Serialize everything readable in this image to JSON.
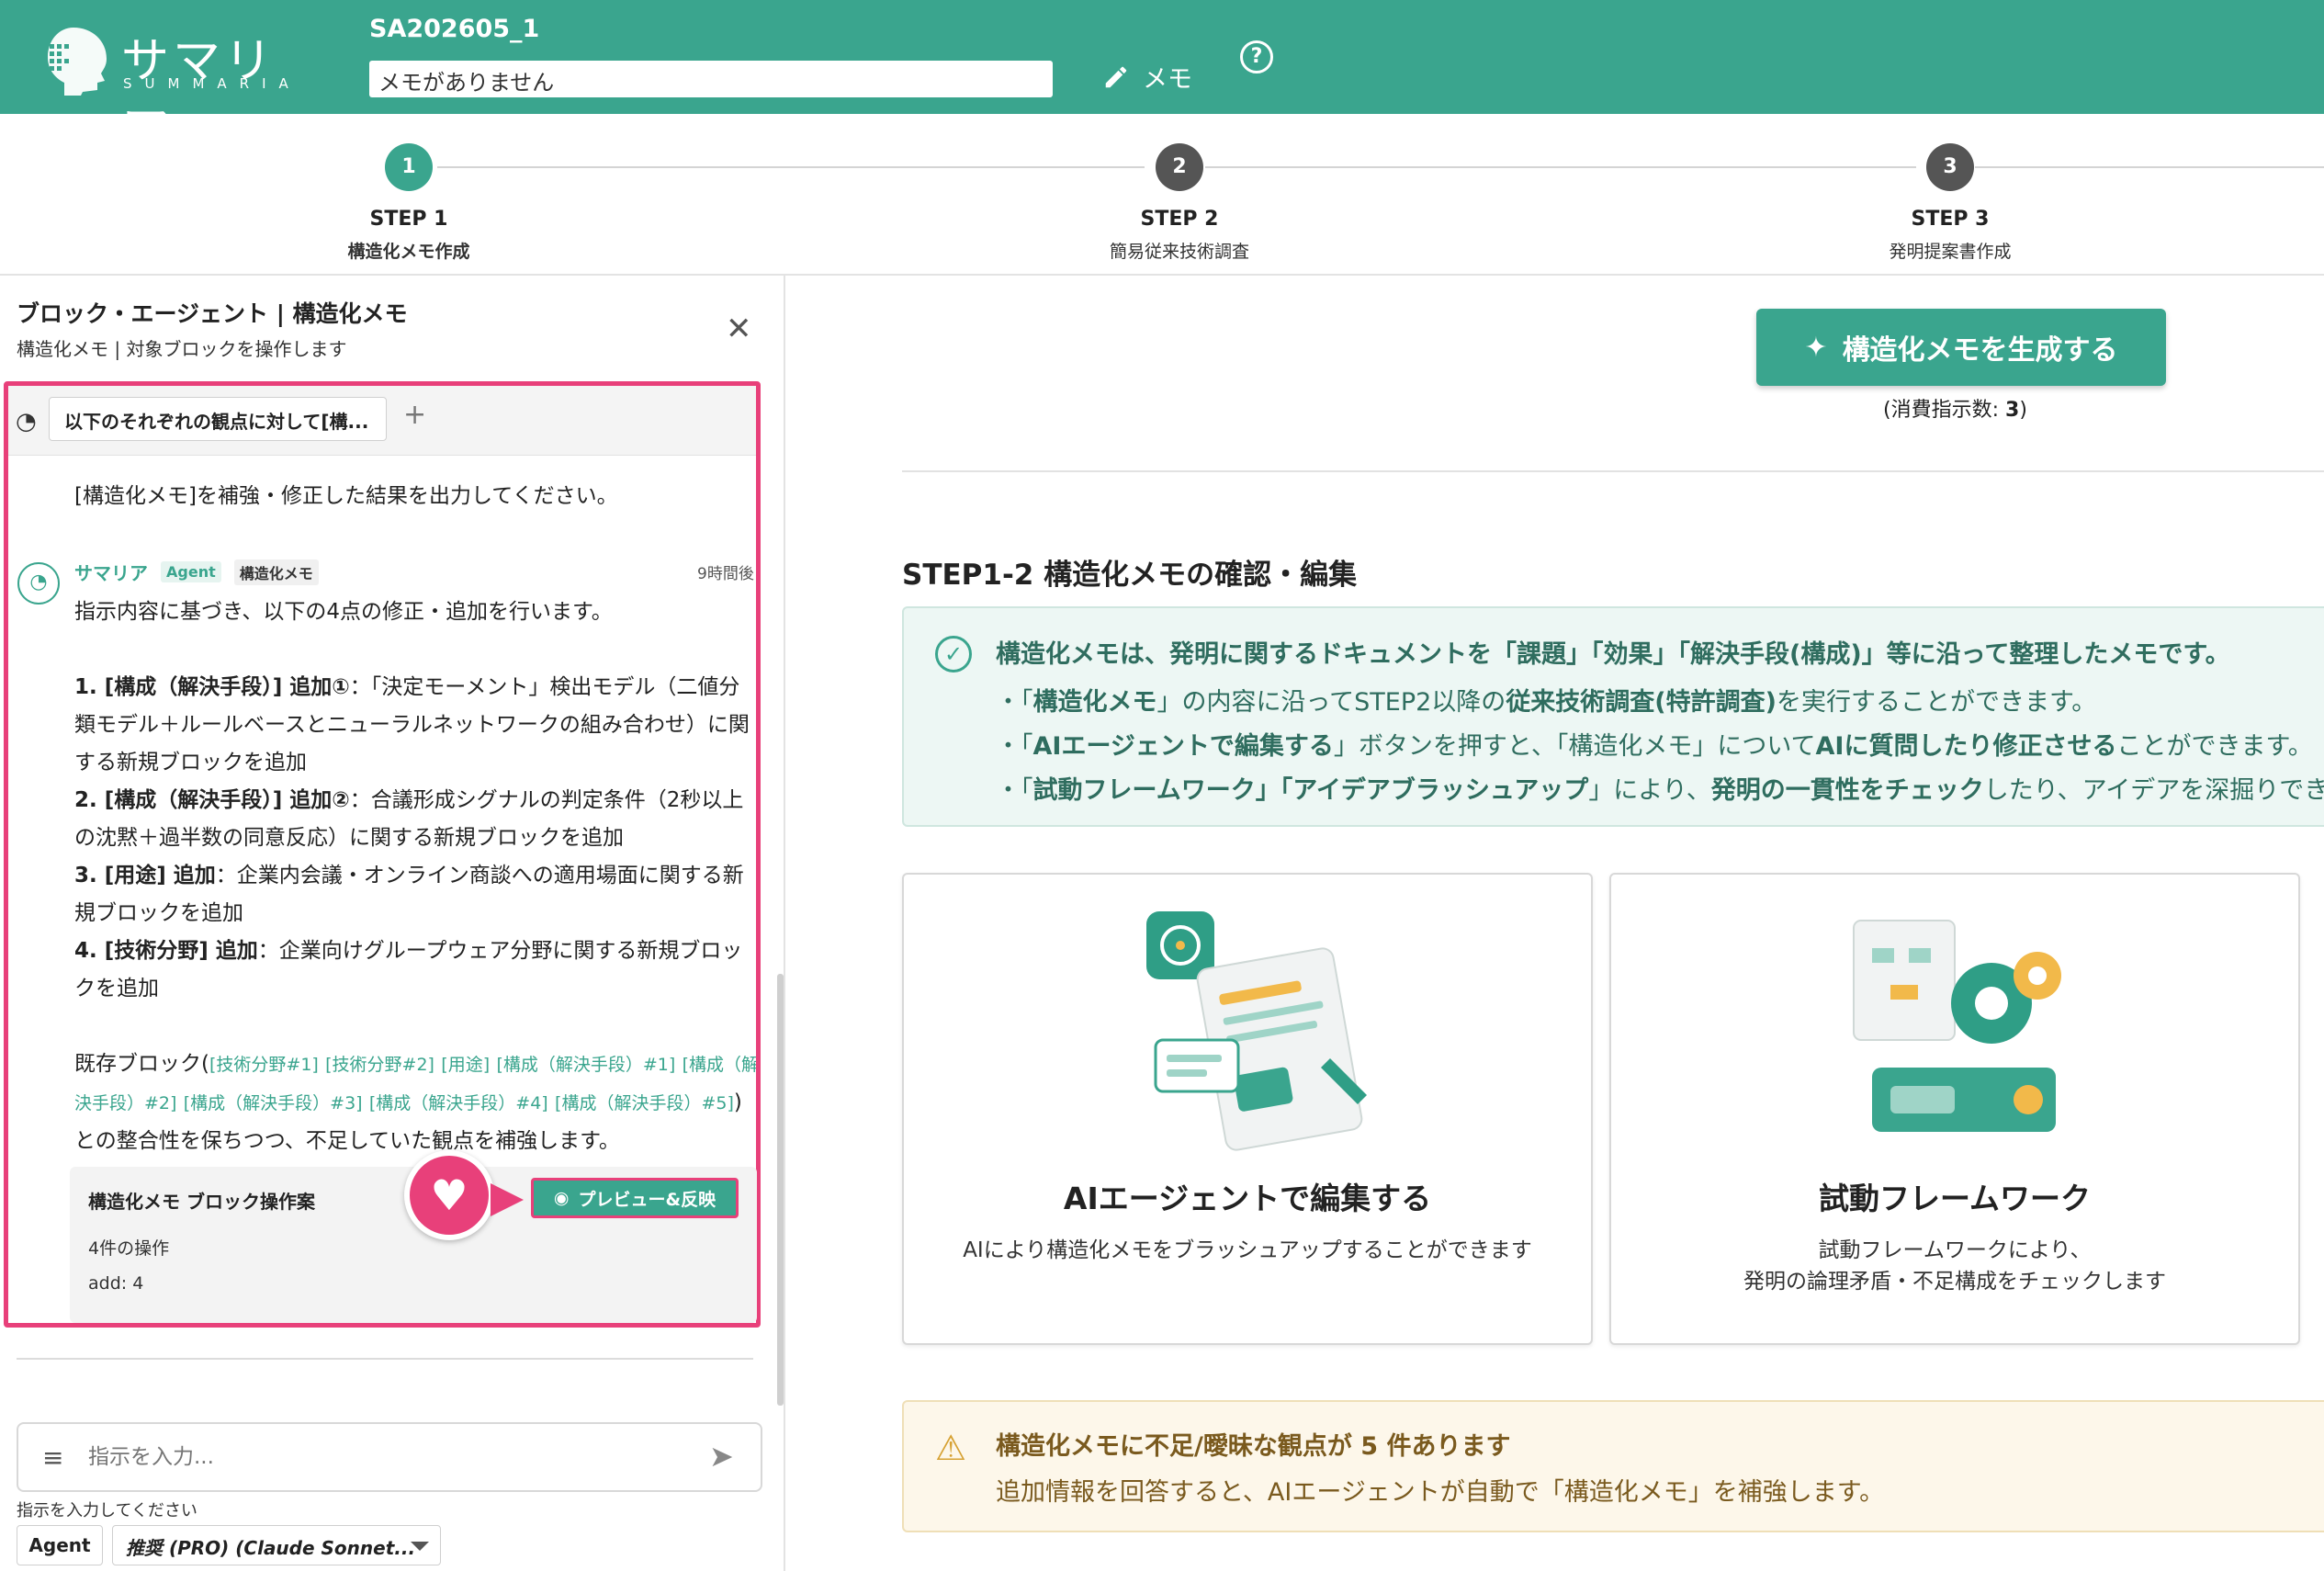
{
  "header": {
    "logo_text": "サマリア",
    "logo_sub": "SUMMARIA",
    "doc_id": "SA202605_1",
    "memo_value": "メモがありません",
    "memo_label": "メモ",
    "help": "?"
  },
  "stepper": {
    "steps": [
      {
        "num": "1",
        "label": "STEP 1",
        "sub": "構造化メモ作成"
      },
      {
        "num": "2",
        "label": "STEP 2",
        "sub": "簡易従来技術調査"
      },
      {
        "num": "3",
        "label": "STEP 3",
        "sub": "発明提案書作成"
      }
    ]
  },
  "left_panel": {
    "title": "ブロック・エージェント | 構造化メモ",
    "subtitle": "構造化メモ | 対象ブロックを操作します",
    "tab_label": "以下のそれぞれの観点に対して[構...",
    "user_message": "[構造化メモ]を補強・修正した結果を出力してください。",
    "bot_name": "サマリア",
    "badge_agent": "Agent",
    "badge_memo": "構造化メモ",
    "bot_time": "9時間後",
    "intro": "指示内容に基づき、以下の4点の修正・追加を行います。",
    "items": [
      {
        "head": "1. [構成（解決手段）] 追加①",
        "body": "：「決定モーメント」検出モデル（二値分類モデル＋ルールベースとニューラルネットワークの組み合わせ）に関する新規ブロックを追加"
      },
      {
        "head": "2. [構成（解決手段）] 追加②",
        "body": "：合議形成シグナルの判定条件（2秒以上の沈黙＋過半数の同意反応）に関する新規ブロックを追加"
      },
      {
        "head": "3. [用途] 追加",
        "body": "：企業内会議・オンライン商談への適用場面に関する新規ブロックを追加"
      },
      {
        "head": "4. [技術分野] 追加",
        "body": "：企業向けグループウェア分野に関する新規ブロックを追加"
      }
    ],
    "existing_prefix": "既存ブロック(",
    "existing_links": [
      "[技術分野#1]",
      "[技術分野#2]",
      "[用途]",
      "[構成（解決手段）#1]",
      "[構成（解決手段）#2]",
      "[構成（解決手段）#3]",
      "[構成（解決手段）#4]",
      "[構成（解決手段）#5]"
    ],
    "existing_suffix": ")との整合性を保ちつつ、不足していた観点を補強します。",
    "op_card": {
      "title": "構造化メモ ブロック操作案",
      "count": "4件の操作",
      "add": "add: 4",
      "preview_label": "プレビュー&反映"
    },
    "input_placeholder": "指示を入力...",
    "input_hint": "指示を入力してください",
    "agent_label": "Agent",
    "model_label": "推奨 (PRO) (Claude Sonnet..."
  },
  "right_panel": {
    "generate_label": "構造化メモを生成する",
    "consume_prefix": "(消費指示数: ",
    "consume_value": "3",
    "consume_suffix": ")",
    "section_title": "STEP1-2 構造化メモの確認・編集",
    "info_head": "構造化メモは、発明に関するドキュメントを「課題」「効果」「解決手段(構成)」等に沿って整理したメモです。",
    "info_lines": [
      {
        "a": "・「",
        "b": "構造化メモ",
        "c": "」の内容に沿ってSTEP2以降の",
        "d": "従来技術調査(特許調査)",
        "e": "を実行することができます。"
      },
      {
        "a": "・「",
        "b": "AIエージェントで編集する",
        "c": "」ボタンを押すと、「構造化メモ」について",
        "d": "AIに質問したり修正させる",
        "e": "ことができます。"
      },
      {
        "a": "・「",
        "b": "試動フレームワーク」「アイデアブラッシュアップ",
        "c": "」により、",
        "d": "発明の一貫性をチェック",
        "e": "したり、アイデアを深掘りできます。"
      }
    ],
    "cards": [
      {
        "title": "AIエージェントで編集する",
        "desc1": "AIにより構造化メモをブラッシュアップすることができます",
        "desc2": ""
      },
      {
        "title": "試動フレームワーク",
        "desc1": "試動フレームワークにより、",
        "desc2": "発明の論理矛盾・不足構成をチェックします"
      }
    ],
    "warn_head": "構造化メモに不足/曖昧な観点が 5 件あります",
    "warn_sub": "追加情報を回答すると、AIエージェントが自動で「構造化メモ」を補強します。"
  },
  "colors": {
    "brand": "#3aa58e",
    "highlight": "#e8407a",
    "warn": "#d6a132"
  }
}
